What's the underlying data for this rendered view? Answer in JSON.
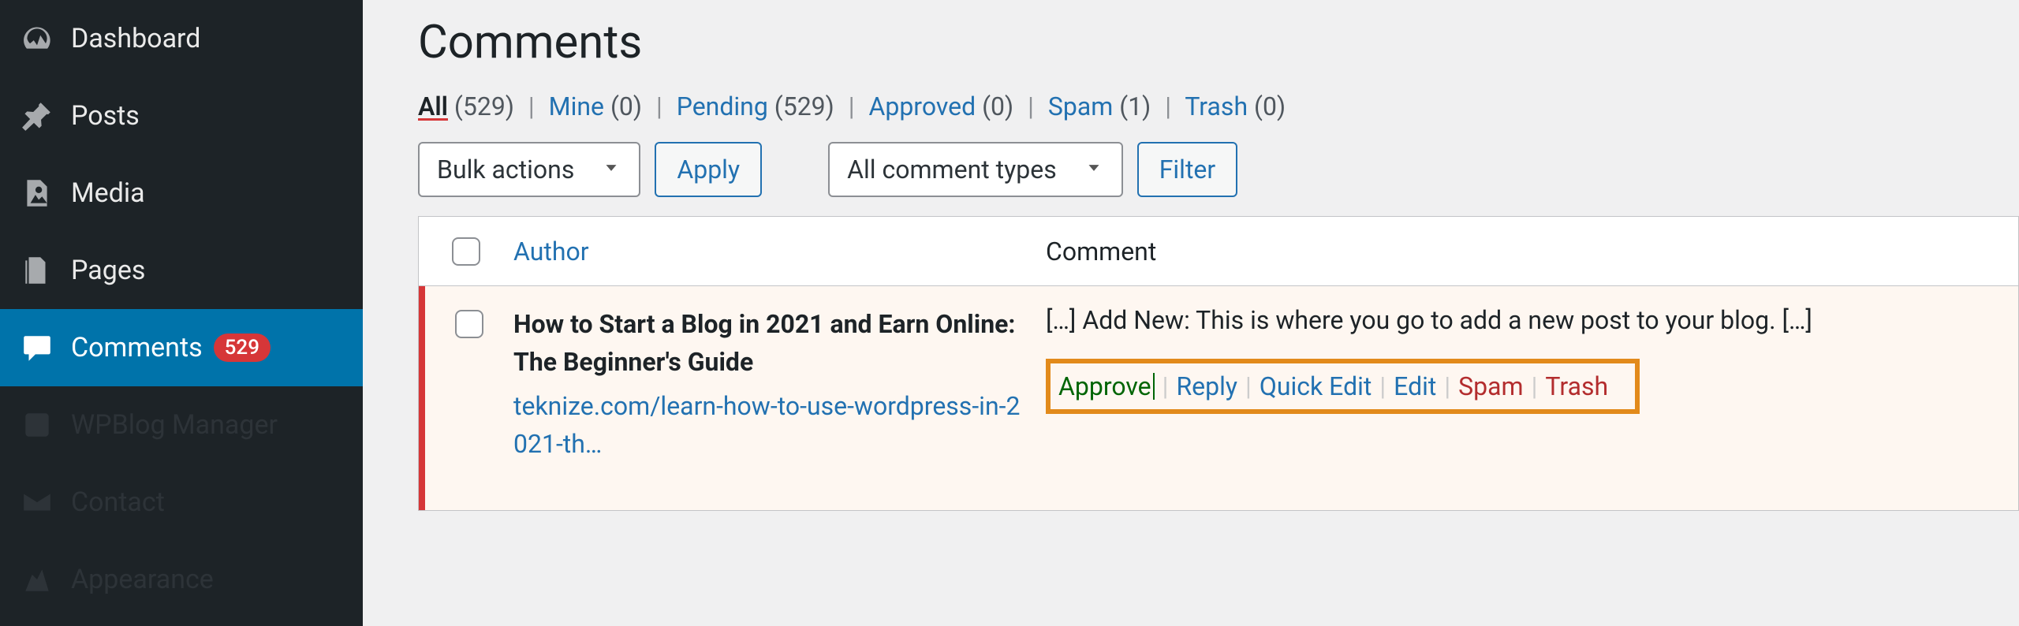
{
  "sidebar": {
    "items": [
      {
        "label": "Dashboard"
      },
      {
        "label": "Posts"
      },
      {
        "label": "Media"
      },
      {
        "label": "Pages"
      },
      {
        "label": "Comments",
        "badge": "529"
      },
      {
        "label": "WPBlog Manager"
      },
      {
        "label": "Contact"
      },
      {
        "label": "Appearance"
      }
    ]
  },
  "page": {
    "title": "Comments"
  },
  "filters": {
    "all_label": "All",
    "all_count": "(529)",
    "mine_label": "Mine",
    "mine_count": "(0)",
    "pending_label": "Pending",
    "pending_count": "(529)",
    "approved_label": "Approved",
    "approved_count": "(0)",
    "spam_label": "Spam",
    "spam_count": "(1)",
    "trash_label": "Trash",
    "trash_count": "(0)"
  },
  "actions": {
    "bulk": "Bulk actions",
    "apply": "Apply",
    "types": "All comment types",
    "filter": "Filter"
  },
  "table": {
    "headers": {
      "author": "Author",
      "comment": "Comment"
    },
    "rows": [
      {
        "title": "How to Start a Blog in 2021 and Earn Online: The Beginner's Guide",
        "url": "teknize.com/learn-how-to-use-wordpress-in-2021-th…",
        "text": "[…] Add New: This is where you go to add a new post to your blog. […]",
        "approve": "Approve",
        "reply": "Reply",
        "quick_edit": "Quick Edit",
        "edit": "Edit",
        "spam": "Spam",
        "trash": "Trash"
      }
    ]
  }
}
